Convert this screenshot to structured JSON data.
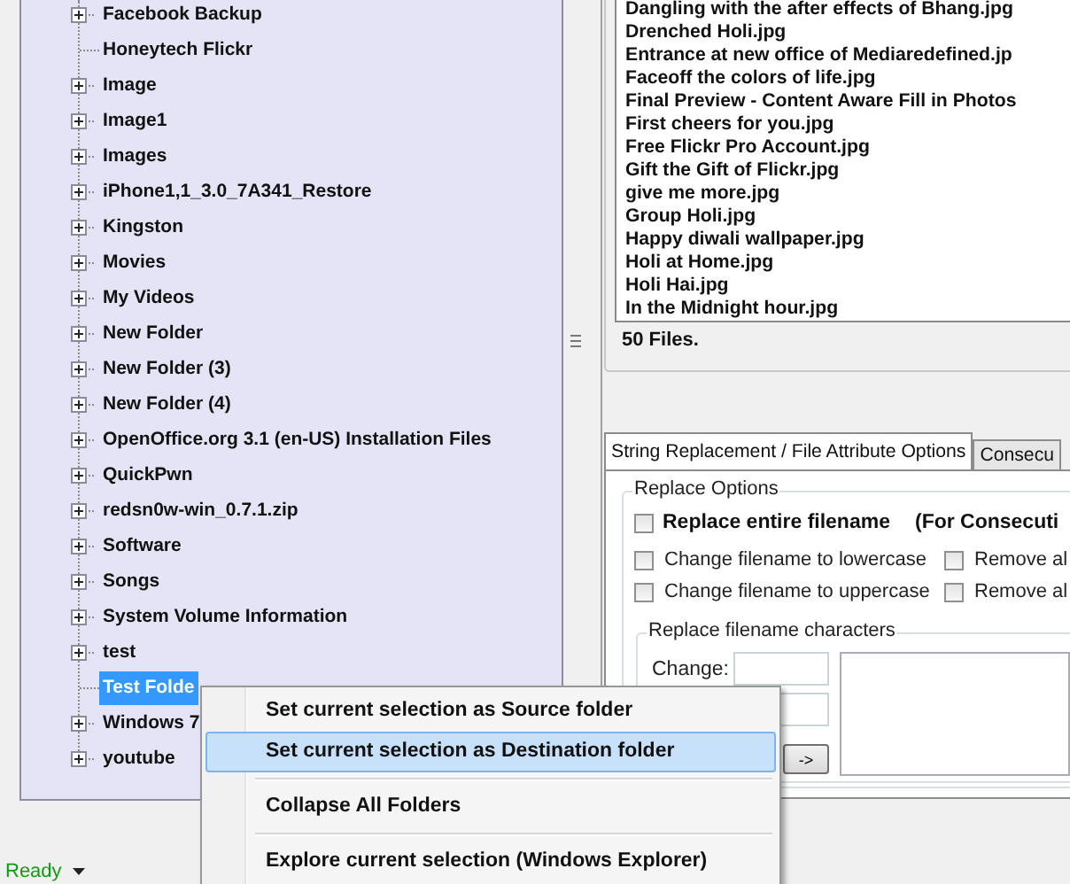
{
  "tree": {
    "items": [
      {
        "label": "Facebook Backup",
        "expandable": true,
        "selected": false
      },
      {
        "label": "Honeytech Flickr",
        "expandable": false,
        "selected": false
      },
      {
        "label": "Image",
        "expandable": true,
        "selected": false
      },
      {
        "label": "Image1",
        "expandable": true,
        "selected": false
      },
      {
        "label": "Images",
        "expandable": true,
        "selected": false
      },
      {
        "label": "iPhone1,1_3.0_7A341_Restore",
        "expandable": true,
        "selected": false
      },
      {
        "label": "Kingston",
        "expandable": true,
        "selected": false
      },
      {
        "label": "Movies",
        "expandable": true,
        "selected": false
      },
      {
        "label": "My Videos",
        "expandable": true,
        "selected": false
      },
      {
        "label": "New Folder",
        "expandable": true,
        "selected": false
      },
      {
        "label": "New Folder (3)",
        "expandable": true,
        "selected": false
      },
      {
        "label": "New Folder (4)",
        "expandable": true,
        "selected": false
      },
      {
        "label": "OpenOffice.org 3.1 (en-US) Installation Files",
        "expandable": true,
        "selected": false
      },
      {
        "label": "QuickPwn",
        "expandable": true,
        "selected": false
      },
      {
        "label": "redsn0w-win_0.7.1.zip",
        "expandable": true,
        "selected": false
      },
      {
        "label": "Software",
        "expandable": true,
        "selected": false
      },
      {
        "label": "Songs",
        "expandable": true,
        "selected": false
      },
      {
        "label": "System Volume Information",
        "expandable": true,
        "selected": false
      },
      {
        "label": "test",
        "expandable": true,
        "selected": false
      },
      {
        "label": "Test Folde",
        "expandable": false,
        "selected": true
      },
      {
        "label": "Windows 7",
        "expandable": true,
        "selected": false
      },
      {
        "label": "youtube",
        "expandable": true,
        "selected": false
      }
    ]
  },
  "file_list": {
    "items": [
      "Dangling with the after effects of Bhang.jpg",
      "Drenched Holi.jpg",
      "Entrance at new office of Mediaredefined.jp",
      "Faceoff the colors of life.jpg",
      "Final Preview - Content Aware Fill in Photos",
      "First cheers for you.jpg",
      "Free Flickr Pro Account.jpg",
      "Gift the Gift of Flickr.jpg",
      "give me more.jpg",
      "Group Holi.jpg",
      "Happy diwali wallpaper.jpg",
      "Holi at Home.jpg",
      "Holi Hai.jpg",
      "In the Midnight hour.jpg"
    ],
    "count": "50 Files."
  },
  "tabs": [
    {
      "label": "String Replacement / File Attribute Options",
      "selected": true
    },
    {
      "label": "Consecu",
      "selected": false
    }
  ],
  "replace_options": {
    "title": "Replace Options",
    "replace_entire": {
      "label": "Replace entire filename",
      "note": "(For Consecuti",
      "checked": false
    },
    "checkboxes": [
      {
        "label": "Change filename to lowercase",
        "checked": false
      },
      {
        "label": "Remove al",
        "checked": false
      },
      {
        "label": "Change filename to uppercase",
        "checked": false
      },
      {
        "label": "Remove al",
        "checked": false
      }
    ],
    "replace_chars": {
      "title": "Replace filename characters",
      "change_label": "Change:",
      "arrow_button": "->"
    }
  },
  "context_menu": {
    "items": [
      {
        "kind": "item",
        "label": "Set current selection as Source folder",
        "selected": false
      },
      {
        "kind": "item",
        "label": "Set current selection as Destination folder",
        "selected": true
      },
      {
        "kind": "separator"
      },
      {
        "kind": "item",
        "label": "Collapse All Folders",
        "selected": false
      },
      {
        "kind": "separator"
      },
      {
        "kind": "item",
        "label": "Explore current selection (Windows Explorer)",
        "selected": false
      }
    ]
  },
  "status_bar": {
    "text": "Ready"
  }
}
